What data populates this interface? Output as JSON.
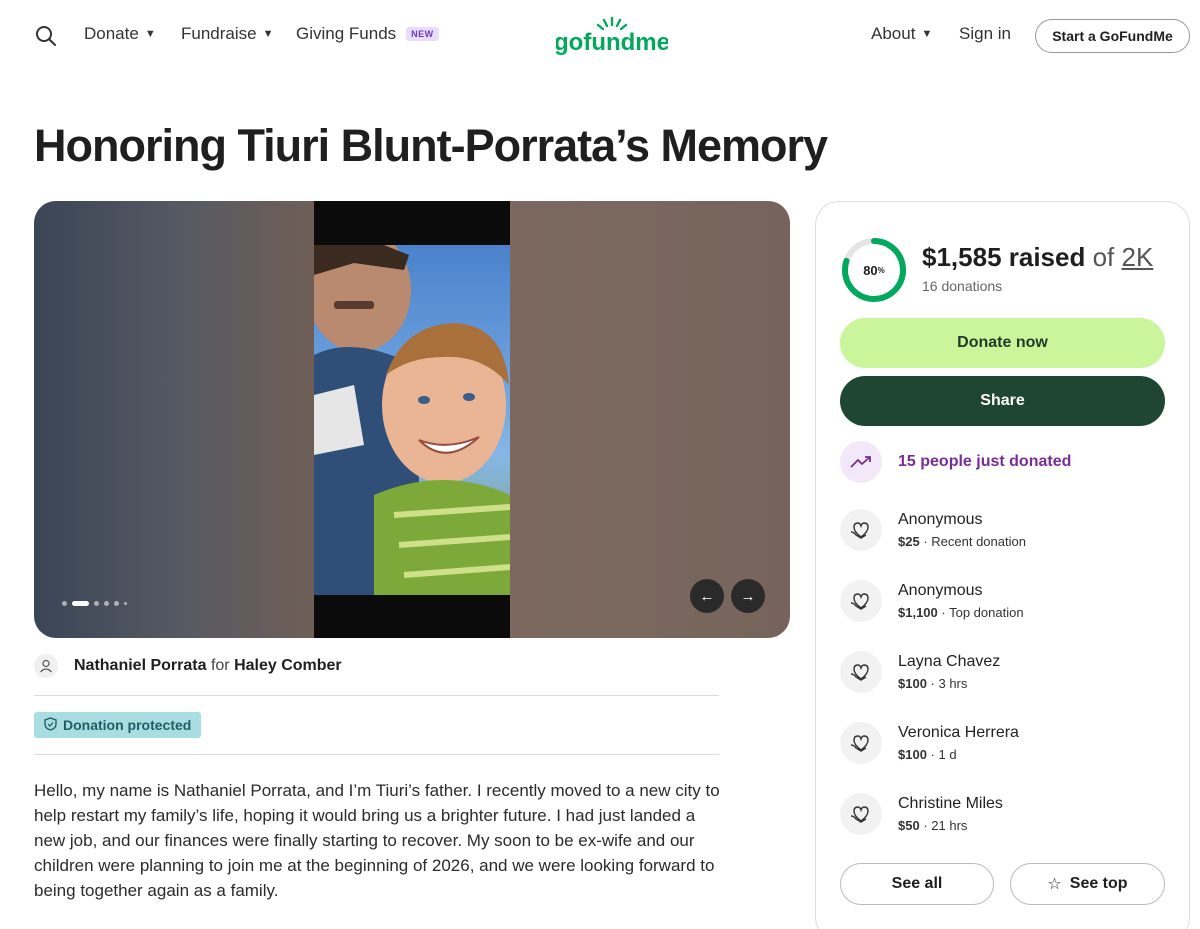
{
  "header": {
    "nav": {
      "donate": "Donate",
      "fundraise": "Fundraise",
      "giving_funds": "Giving Funds",
      "new_badge": "NEW",
      "about": "About",
      "sign_in": "Sign in"
    },
    "logo_text": "gofundme",
    "start_button": "Start a GoFundMe"
  },
  "campaign": {
    "title": "Honoring Tiuri Blunt-Porrata’s Memory",
    "media": {
      "dot_count": 6,
      "active_dot": 1
    },
    "organizer": {
      "name": "Nathaniel Porrata",
      "for_word": "for",
      "beneficiary": "Haley Comber"
    },
    "protected_label": "Donation protected",
    "story": "Hello, my name is Nathaniel Porrata, and I’m Tiuri’s father. I recently moved to a new city to help restart my family’s life, hoping it would bring us a brighter future. I had just landed a new job, and our finances were finally starting to recover. My soon to be ex-wife and our children were planning to join me at the beginning of 2026, and we were looking forward to being together again as a family."
  },
  "sidebar": {
    "progress_percent": 80,
    "percent_label": "80",
    "percent_sign": "%",
    "raised_amount": "$1,585 raised",
    "of_word": "of",
    "goal": "2K",
    "donations_count": "16 donations",
    "donate_button": "Donate now",
    "share_button": "Share",
    "trend_text": "15 people just donated",
    "donors": [
      {
        "name": "Anonymous",
        "amount": "$25",
        "detail": "Recent donation"
      },
      {
        "name": "Anonymous",
        "amount": "$1,100",
        "detail": "Top donation"
      },
      {
        "name": "Layna Chavez",
        "amount": "$100",
        "detail": "3 hrs"
      },
      {
        "name": "Veronica Herrera",
        "amount": "$100",
        "detail": "1 d"
      },
      {
        "name": "Christine Miles",
        "amount": "$50",
        "detail": "21 hrs"
      }
    ],
    "see_all_button": "See all",
    "see_top_button": "See top"
  },
  "colors": {
    "brand_green": "#02a95c",
    "donate_bg": "#cbf59a",
    "share_bg": "#1f4633",
    "trend_purple": "#7a2c95",
    "protected_bg": "#a9dde2"
  }
}
